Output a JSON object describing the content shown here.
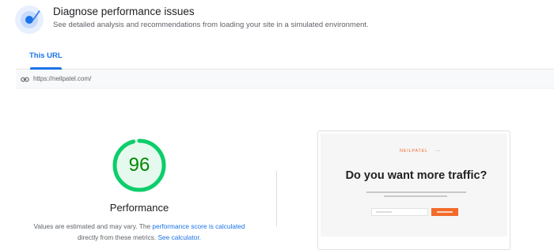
{
  "header": {
    "title": "Diagnose performance issues",
    "subtitle": "See detailed analysis and recommendations from loading your site in a simulated environment.",
    "icon": "lab-icon"
  },
  "tabs": [
    {
      "label": "This URL",
      "active": true
    }
  ],
  "url_bar": {
    "icon": "link-icon",
    "url": "https://neilpatel.com/"
  },
  "performance": {
    "score": "96",
    "score_fraction": 0.96,
    "label": "Performance",
    "note_prefix": "Values are estimated and may vary. The",
    "note_link_1": "performance score is calculated",
    "note_middle": "directly from these metrics.",
    "note_link_2": "See calculator."
  },
  "preview": {
    "site_logo": "NEILPATEL",
    "headline": "Do you want more traffic?"
  },
  "colors": {
    "accent": "#1a73e8",
    "score_good": "#0cce6b",
    "score_good_text": "#008800",
    "score_good_fill": "#e6f9ee",
    "brand_orange": "#f26b2b"
  }
}
